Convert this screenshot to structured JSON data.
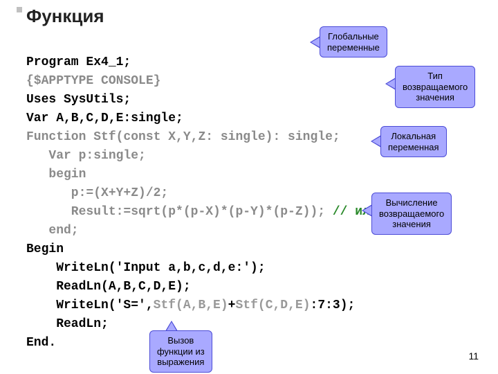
{
  "title": "Функция",
  "code_lines": {
    "l1a": "Program Ex4_1;",
    "l2a": "{$APPTYPE CONSOLE}",
    "l3a": "Uses SysUtils;",
    "l4a": "Var A,B,C,D,E:single;",
    "l5a": "Function Stf(const X,Y,Z: single): single;",
    "l6a": "   Var p:single;",
    "l7a": "   begin",
    "l8a": "      p:=(X+Y+Z)/2;",
    "l9a": "      Result:=sqrt(p*(p-X)*(p-Y)*(p-Z));",
    "l9b": " // или Stf:=..",
    "l10a": "   end;",
    "l11a": "Begin",
    "l12a": "    WriteLn('Input a,b,c,d,e:');",
    "l13a": "    ReadLn(A,B,C,D,E);",
    "l14a": "    WriteLn('S=',",
    "l14b": "Stf(A,B,E)",
    "l14c": "+",
    "l14d": "Stf(C,D,E)",
    "l14e": ":7:3);",
    "l15a": "    ReadLn;",
    "l16a": "End."
  },
  "callouts": {
    "global": "Глобальные\nпеременные",
    "rettype": "Тип\nвозвращаемого\nзначения",
    "local": "Локальная\nпеременная",
    "calc": "Вычисление\nвозвращаемого\nзначения",
    "call": "Вызов\nфункции из\nвыражения"
  },
  "pagenum": "11"
}
